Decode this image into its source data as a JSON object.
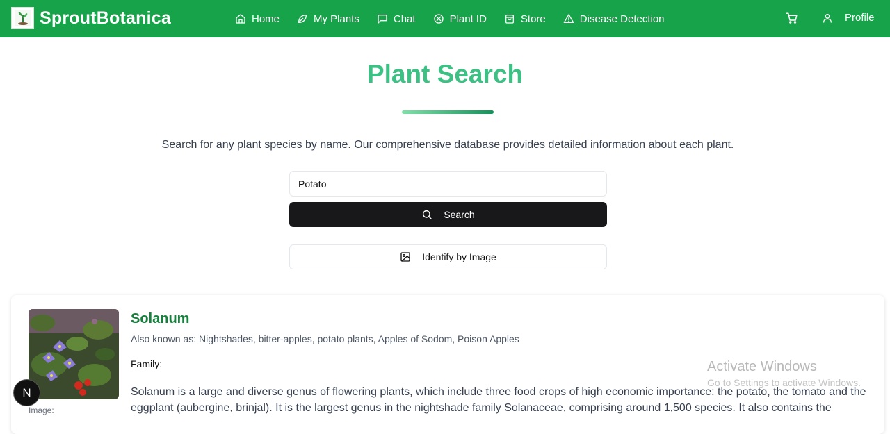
{
  "nav": {
    "brand": "SproutBotanica",
    "items": [
      {
        "label": "Home",
        "icon": "home-icon"
      },
      {
        "label": "My Plants",
        "icon": "leaf-icon"
      },
      {
        "label": "Chat",
        "icon": "chat-icon"
      },
      {
        "label": "Plant ID",
        "icon": "plant-id-icon"
      },
      {
        "label": "Store",
        "icon": "shopping-bag-icon"
      },
      {
        "label": "Disease Detection",
        "icon": "warning-triangle-icon"
      }
    ],
    "profile_label": "Profile",
    "bg_color": "#17a34a"
  },
  "page": {
    "title": "Plant Search",
    "subtitle": "Search for any plant species by name. Our comprehensive database provides detailed information about each plant.",
    "title_color": "#3cc083"
  },
  "search": {
    "value": "Potato",
    "button_label": "Search",
    "identify_label": "Identify by Image"
  },
  "result": {
    "name": "Solanum",
    "also_known_as": "Also known as: Nightshades, bitter-apples, potato plants, Apples of Sodom, Poison Apples",
    "family": "Family:",
    "description": "Solanum is a large and diverse genus of flowering plants, which include three food crops of high economic importance: the potato, the tomato and the eggplant (aubergine, brinjal). It is the largest genus in the nightshade family Solanaceae, comprising around 1,500 species. It also contains the",
    "image_label": "Image:"
  },
  "overlay": {
    "activate_title": "Activate Windows",
    "activate_sub": "Go to Settings to activate Windows.",
    "badge": "N"
  }
}
